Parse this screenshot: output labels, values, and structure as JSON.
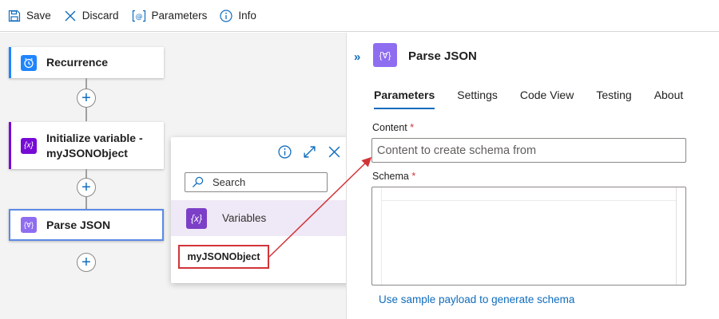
{
  "toolbar": {
    "save": "Save",
    "discard": "Discard",
    "parameters": "Parameters",
    "info": "Info"
  },
  "workflow": {
    "steps": [
      {
        "label": "Recurrence",
        "icon": "clock-icon",
        "color": "#1f85ff"
      },
      {
        "label": "Initialize variable - myJSONObject",
        "line1": "Initialize variable -",
        "line2": "myJSONObject",
        "icon": "variable-icon",
        "color": "#770bd6"
      },
      {
        "label": "Parse JSON",
        "icon": "parse-json-icon",
        "color": "#8f6df0"
      }
    ]
  },
  "popup": {
    "search_placeholder": "Search",
    "group_label": "Variables",
    "group_icon_text": "{x}",
    "item_label": "myJSONObject"
  },
  "panel": {
    "title": "Parse JSON",
    "icon_text": "{∀}",
    "tabs": [
      "Parameters",
      "Settings",
      "Code View",
      "Testing",
      "About"
    ],
    "active_tab": "Parameters",
    "content_label": "Content",
    "content_placeholder": "Content to create schema from",
    "schema_label": "Schema",
    "required_mark": "*",
    "sample_link": "Use sample payload to generate schema"
  },
  "colors": {
    "accent": "#0f6cbd",
    "highlight": "#d13438",
    "variables_purple": "#7c3fc7"
  }
}
